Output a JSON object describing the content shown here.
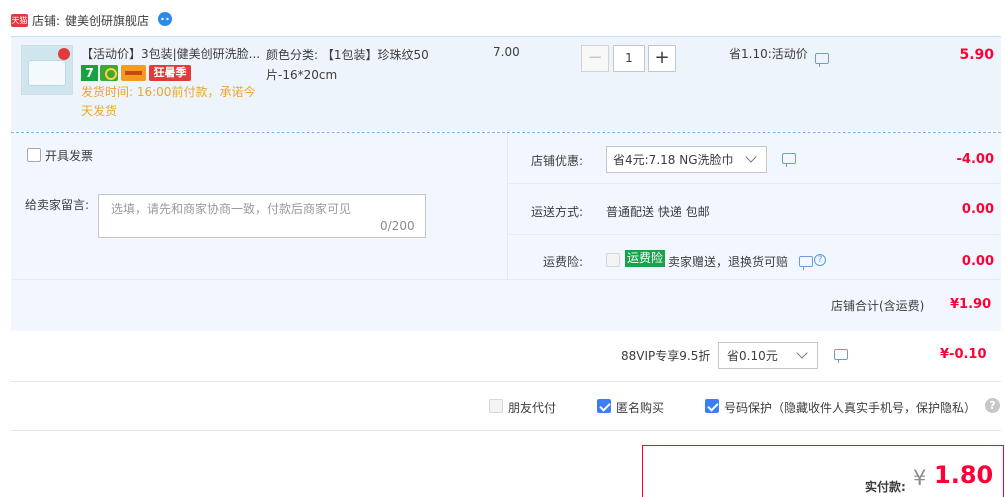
{
  "shop": {
    "badge": "天猫",
    "prefix": "店铺:",
    "name": "健美创研旗舰店",
    "chat_icon": "wangwang-chat-icon"
  },
  "item": {
    "title": "【活动价】3包装|健美创研洗脸...",
    "badge_seven": "7",
    "badge_sale": "狂暑季",
    "ship_time": "发货时间: 16:00前付款，承诺今天发货",
    "sku_label": "颜色分类: 【1包装】珍珠纹50片-16*20cm",
    "unit_price": "7.00",
    "quantity": "1",
    "qty_minus": "−",
    "qty_plus": "+",
    "promo": "省1.10:活动价",
    "total": "5.90"
  },
  "invoice": {
    "label": "开具发票"
  },
  "memo": {
    "label": "给卖家留言:",
    "placeholder": "选填，请先和商家协商一致，付款后商家可见",
    "count": "0/200"
  },
  "shop_coupon": {
    "label": "店铺优惠:",
    "selected": "省4元:7.18 NG洗脸巾",
    "amount": "-4.00"
  },
  "shipping": {
    "label": "运送方式:",
    "value": "普通配送 快递 包邮",
    "amount": "0.00"
  },
  "insurance": {
    "label": "运费险:",
    "tag": "运费险",
    "desc": "卖家赠送，退换货可赔",
    "amount": "0.00"
  },
  "shop_total": {
    "label": "店铺合计(含运费)",
    "value": "¥1.90"
  },
  "vip": {
    "label": "88VIP专享9.5折",
    "selected": "省0.10元",
    "amount": "¥-0.10"
  },
  "options": {
    "friend_pay": "朋友代付",
    "anonymous": "匿名购买",
    "number_protect": "号码保护（隐藏收件人真实手机号，保护隐私）"
  },
  "payment": {
    "label": "实付款:",
    "currency": "¥",
    "amount": "1.80"
  },
  "colors": {
    "accent_red": "#ff0036",
    "brand_blue": "#3b7ef6",
    "row_bg": "#eef4fb",
    "ship_orange": "#f0a524"
  }
}
